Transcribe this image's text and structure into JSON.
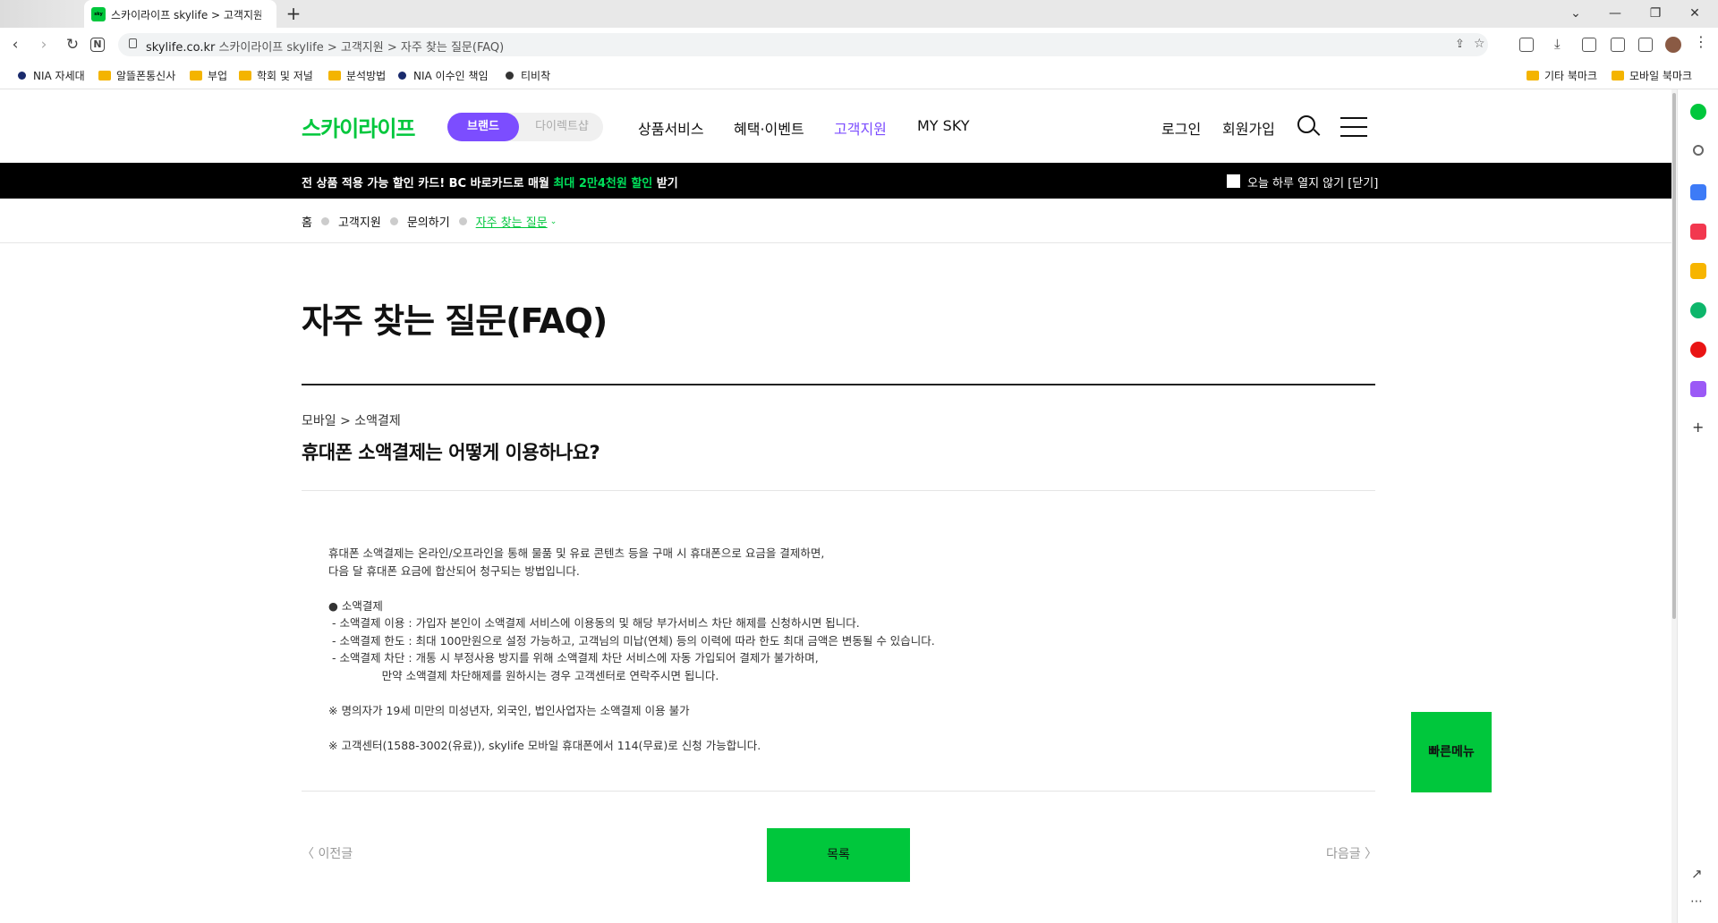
{
  "browser": {
    "tab_title": "스카이라이프 skylife > 고객지원",
    "tab_favicon": "sky",
    "new_tab": "+",
    "url_domain": "skylife.co.kr",
    "url_path": " 스카이라이프 skylife > 고객지원 > 자주 찾는 질문(FAQ)",
    "bookmarks": [
      {
        "label": "NIA 자세대",
        "type": "dot"
      },
      {
        "label": "알뜰폰통신사",
        "type": "folder"
      },
      {
        "label": "부업",
        "type": "folder"
      },
      {
        "label": "학회 및 저널",
        "type": "folder"
      },
      {
        "label": "분석방법",
        "type": "folder"
      },
      {
        "label": "NIA 이수인 책임",
        "type": "dot"
      },
      {
        "label": "티비착",
        "type": "dot"
      }
    ],
    "bookmarks_right": [
      "기타 북마크",
      "모바일 북마크"
    ]
  },
  "header": {
    "logo": "스카이라이프",
    "toggle_on": "브랜드",
    "toggle_off": "다이렉트샵",
    "nav": [
      "상품서비스",
      "혜택·이벤트",
      "고객지원",
      "MY SKY"
    ],
    "login": "로그인",
    "signup": "회원가입"
  },
  "promo": {
    "text_before": "전 상품 적용 가능 할인 카드! BC 바로카드로 매월 ",
    "text_highlight": "최대 2만4천원 할인",
    "text_after": " 받기",
    "close_label": "오늘 하루 열지 않기 [닫기]"
  },
  "breadcrumb": [
    "홈",
    "고객지원",
    "문의하기",
    "자주 찾는 질문"
  ],
  "page": {
    "title": "자주 찾는 질문(FAQ)",
    "category": "모바일 > 소액결제",
    "question": "휴대폰 소액결제는 어떻게 이용하나요?",
    "answer": "휴대폰 소액결제는 온라인/오프라인을 통해 물품 및 유료 콘텐츠 등을 구매 시 휴대폰으로 요금을 결제하면,\n다음 달 휴대폰 요금에 합산되어 청구되는 방법입니다.\n\n● 소액결제\n - 소액결제 이용 : 가입자 본인이 소액결제 서비스에 이용동의 및 해당 부가서비스 차단 해제를 신청하시면 됩니다.\n - 소액결제 한도 : 최대 100만원으로 설정 가능하고, 고객님의 미납(연체) 등의 이력에 따라 한도 최대 금액은 변동될 수 있습니다.\n - 소액결제 차단 : 개통 시 부정사용 방지를 위해 소액결제 차단 서비스에 자동 가입되어 결제가 불가하며,\n               만약 소액결제 차단해제를 원하시는 경우 고객센터로 연락주시면 됩니다.\n\n※ 명의자가 19세 미만의 미성년자, 외국인, 법인사업자는 소액결제 이용 불가\n\n※ 고객센터(1588-3002(유료)), skylife 모바일 휴대폰에서 114(무료)로 신청 가능합니다.",
    "prev": "〈 이전글",
    "list": "목록",
    "next": "다음글 〉",
    "quick_menu": "빠른메뉴"
  },
  "colors": {
    "brand_green": "#00c73c",
    "brand_purple": "#7c4dff"
  }
}
